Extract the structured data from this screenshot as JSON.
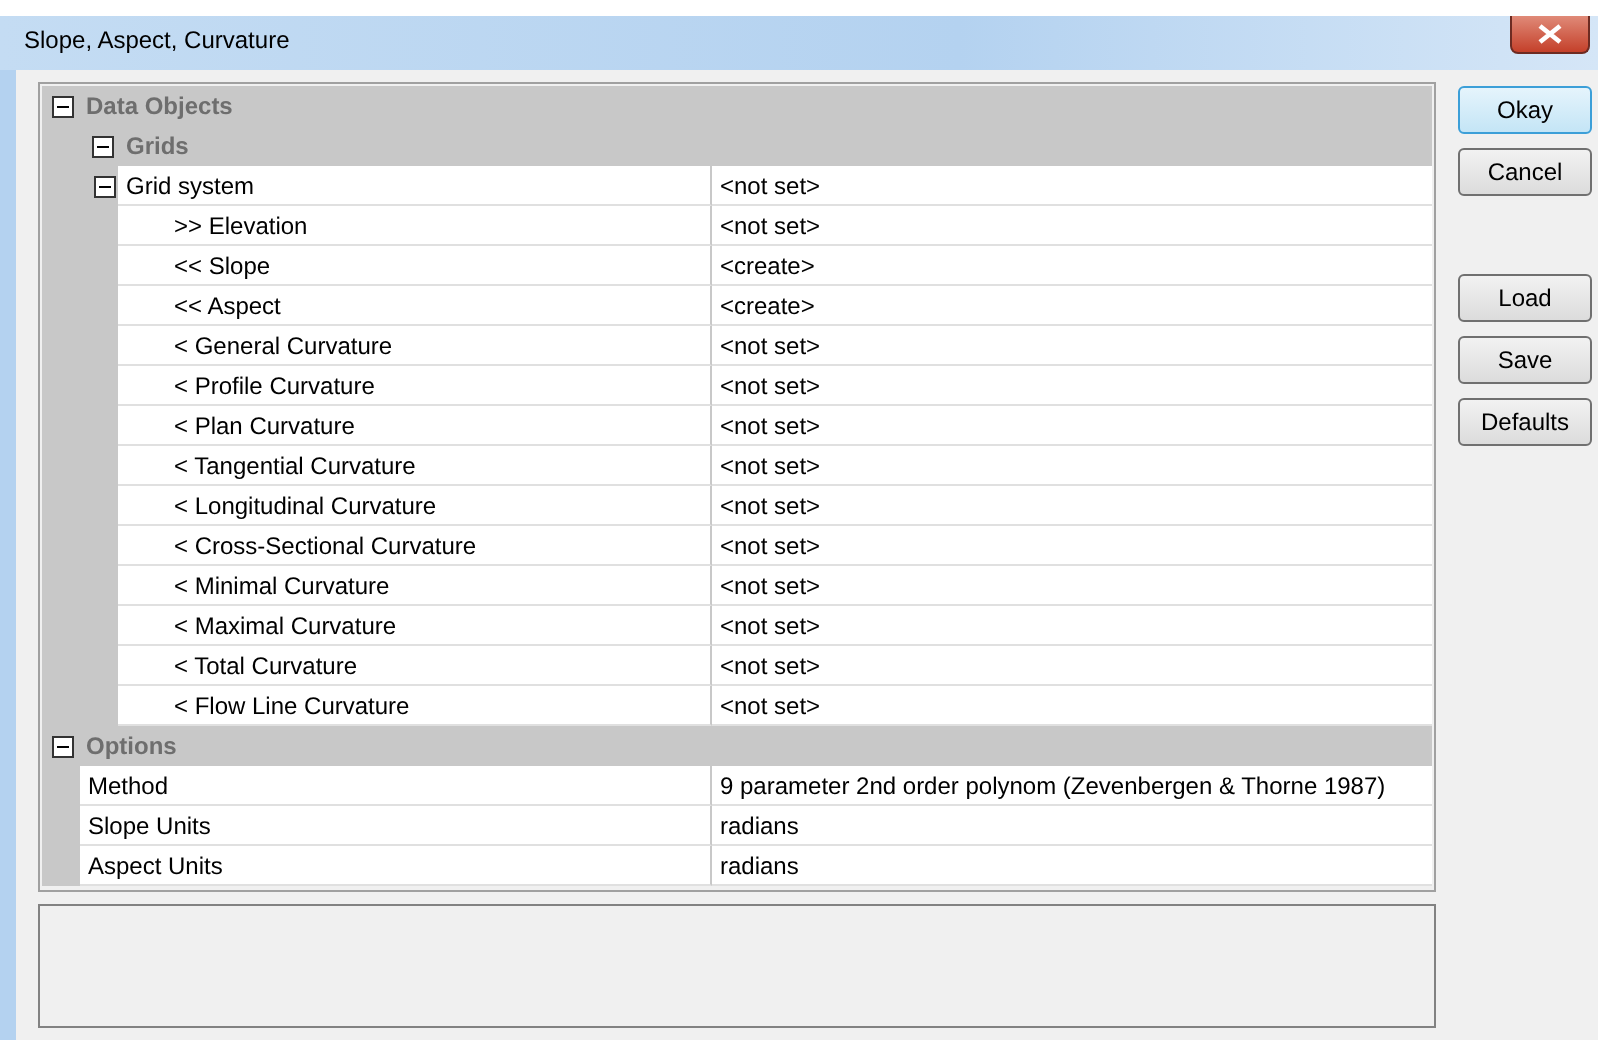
{
  "window": {
    "title": "Slope, Aspect, Curvature"
  },
  "grid": {
    "items": [
      {
        "kind": "category",
        "label": "Data Objects",
        "expanded": true,
        "children": [
          {
            "kind": "category",
            "label": "Grids",
            "expanded": true,
            "children": [
              {
                "kind": "property",
                "label": "Grid system",
                "value": "<not set>",
                "expanded": true,
                "children": [
                  {
                    "kind": "property",
                    "label": ">> Elevation",
                    "value": "<not set>"
                  },
                  {
                    "kind": "property",
                    "label": "<< Slope",
                    "value": "<create>"
                  },
                  {
                    "kind": "property",
                    "label": "<< Aspect",
                    "value": "<create>"
                  },
                  {
                    "kind": "property",
                    "label": "< General Curvature",
                    "value": "<not set>"
                  },
                  {
                    "kind": "property",
                    "label": "< Profile Curvature",
                    "value": "<not set>"
                  },
                  {
                    "kind": "property",
                    "label": "< Plan Curvature",
                    "value": "<not set>"
                  },
                  {
                    "kind": "property",
                    "label": "< Tangential Curvature",
                    "value": "<not set>"
                  },
                  {
                    "kind": "property",
                    "label": "< Longitudinal Curvature",
                    "value": "<not set>"
                  },
                  {
                    "kind": "property",
                    "label": "< Cross-Sectional Curvature",
                    "value": "<not set>"
                  },
                  {
                    "kind": "property",
                    "label": "< Minimal Curvature",
                    "value": "<not set>"
                  },
                  {
                    "kind": "property",
                    "label": "< Maximal Curvature",
                    "value": "<not set>"
                  },
                  {
                    "kind": "property",
                    "label": "< Total Curvature",
                    "value": "<not set>"
                  },
                  {
                    "kind": "property",
                    "label": "< Flow Line Curvature",
                    "value": "<not set>"
                  }
                ]
              }
            ]
          }
        ]
      },
      {
        "kind": "category",
        "label": "Options",
        "expanded": true,
        "children": [
          {
            "kind": "property",
            "label": "Method",
            "value": "9 parameter 2nd order polynom (Zevenbergen & Thorne 1987)"
          },
          {
            "kind": "property",
            "label": "Slope Units",
            "value": "radians"
          },
          {
            "kind": "property",
            "label": "Aspect Units",
            "value": "radians"
          }
        ]
      }
    ]
  },
  "buttons": [
    {
      "label": "Okay",
      "default": true
    },
    {
      "label": "Cancel",
      "default": false
    }
  ],
  "file_buttons": [
    {
      "label": "Load"
    },
    {
      "label": "Save"
    },
    {
      "label": "Defaults"
    }
  ]
}
